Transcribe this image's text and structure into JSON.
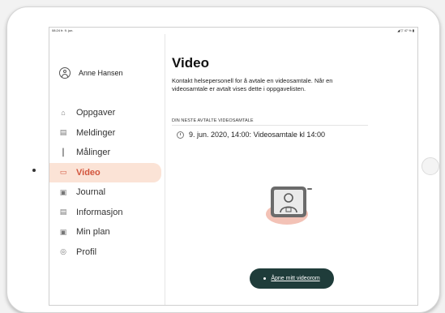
{
  "statusbar": {
    "time": "08:24  fr. 9. jun.",
    "right": "◢ ▽ 47 % ▮"
  },
  "profile": {
    "name": "Anne Hansen"
  },
  "sidebar": {
    "items": [
      {
        "label": "Oppgaver",
        "icon": "home-icon",
        "glyph": "⌂"
      },
      {
        "label": "Meldinger",
        "icon": "chat-icon",
        "glyph": "▤"
      },
      {
        "label": "Målinger",
        "icon": "chart-icon",
        "glyph": "┃"
      },
      {
        "label": "Video",
        "icon": "video-icon",
        "glyph": "▭"
      },
      {
        "label": "Journal",
        "icon": "journal-icon",
        "glyph": "▣"
      },
      {
        "label": "Informasjon",
        "icon": "info-icon",
        "glyph": "▤"
      },
      {
        "label": "Min plan",
        "icon": "plan-icon",
        "glyph": "▣"
      },
      {
        "label": "Profil",
        "icon": "profile-icon",
        "glyph": "◎"
      }
    ],
    "active_index": 3
  },
  "main": {
    "title": "Video",
    "description": "Kontakt helsepersonell for å avtale en videosamtale. Når en videosamtale er avtalt vises dette i oppgavelisten.",
    "section_label": "DIN NESTE AVTALTE VIDEOSAMTALE",
    "appointment": "9. jun. 2020, 14:00: Videosamtale kl 14:00",
    "open_button": "Åpne mitt videorom"
  },
  "colors": {
    "accent": "#d2553d",
    "active_bg": "#fbe3d6",
    "button_bg": "#1f3c3a"
  }
}
